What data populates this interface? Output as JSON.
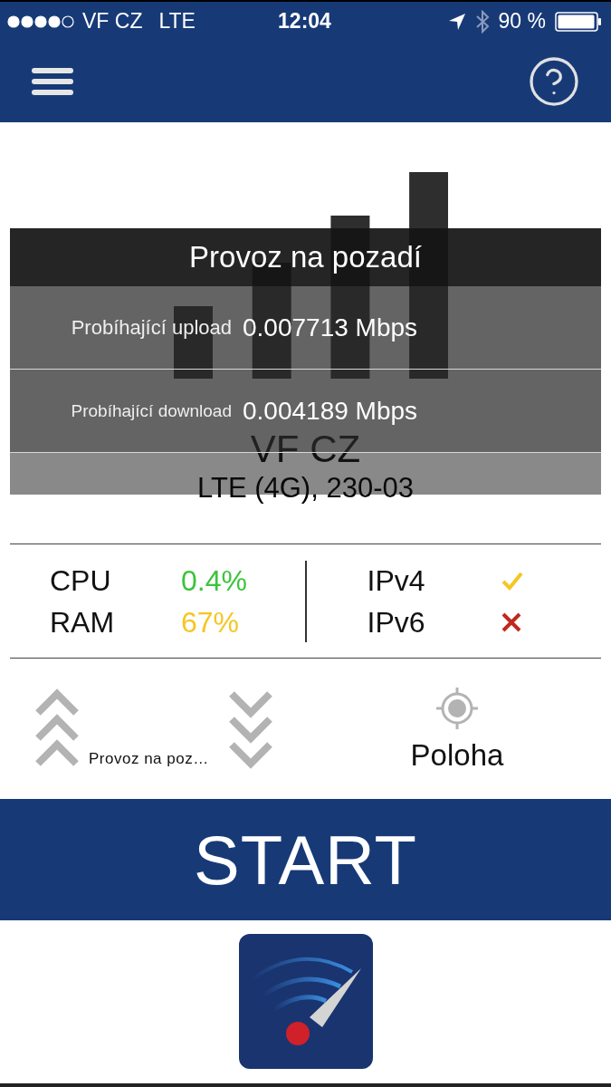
{
  "status_bar": {
    "carrier": "VF CZ",
    "network": "LTE",
    "time": "12:04",
    "battery": "90 %"
  },
  "operator": {
    "name": "VF CZ",
    "network": "LTE (4G), 230-03"
  },
  "background_dialog": {
    "title": "Provoz na pozadí",
    "rows": [
      {
        "label": "Probíhající upload",
        "value": "0.007713 Mbps",
        "kind": "upload"
      },
      {
        "label": "Probíhající download",
        "value": "0.004189 Mbps",
        "kind": "download"
      }
    ]
  },
  "system": [
    {
      "label": "CPU",
      "value": "0.4%",
      "color": "#3cc43c"
    },
    {
      "label": "RAM",
      "value": "67%",
      "color": "#f5c623"
    }
  ],
  "protocols": [
    {
      "label": "IPv4",
      "available": true
    },
    {
      "label": "IPv6",
      "available": false
    }
  ],
  "options": [
    {
      "kind": "upload",
      "label": "Provoz na poz…"
    },
    {
      "kind": "download"
    },
    {
      "kind": "location",
      "label": "Poloha"
    }
  ],
  "start_button": {
    "label": "START"
  }
}
